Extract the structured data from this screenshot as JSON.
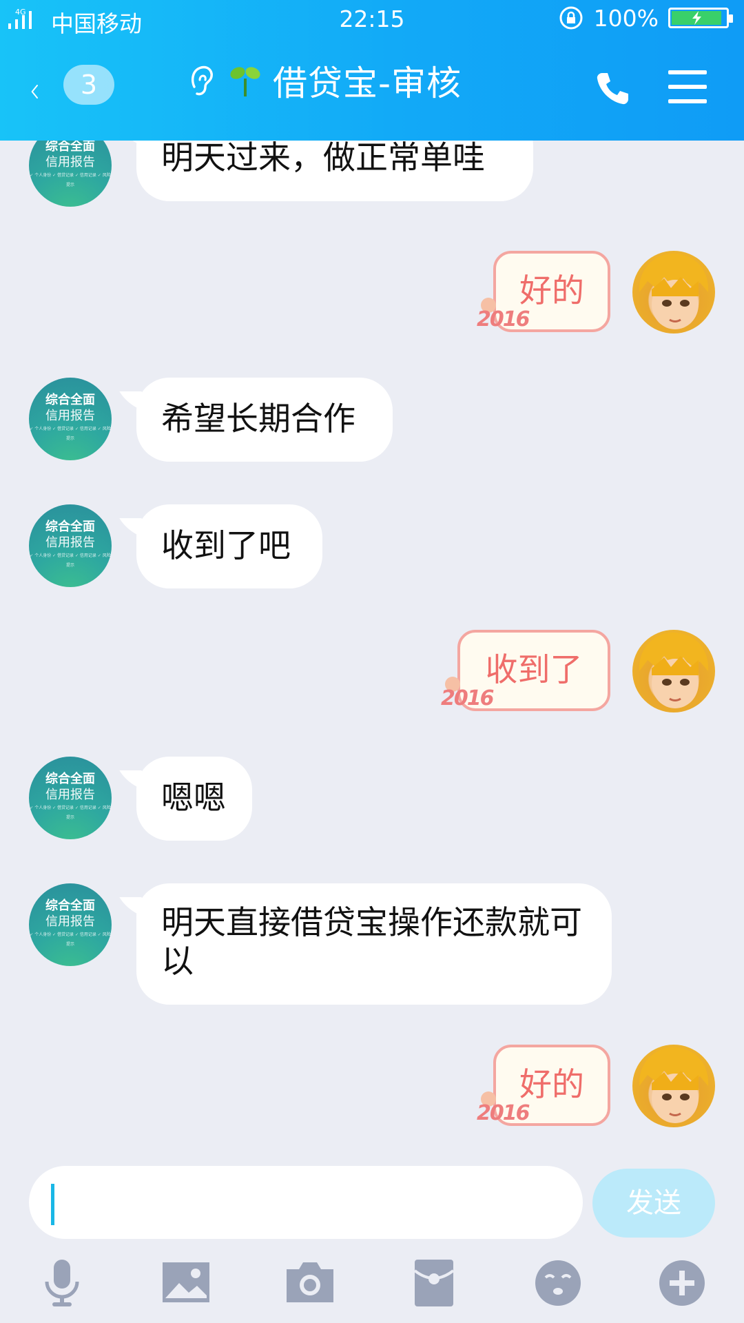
{
  "status_bar": {
    "signal": "4G",
    "carrier": "中国移动",
    "time": "22:15",
    "battery": "100%"
  },
  "header": {
    "unread_count": "3",
    "title": "借贷宝-审核"
  },
  "contact_avatar": {
    "line1": "综合全面",
    "line2": "信用报告",
    "line3": "✓ 个人身份 ✓ 借贷记录 ✓ 信用记录 ✓ 风险提示"
  },
  "messages": [
    {
      "side": "left",
      "text": "明天过来，做正常单哇"
    },
    {
      "side": "right",
      "text": "好的",
      "deco": "2016"
    },
    {
      "side": "left",
      "text": "希望长期合作"
    },
    {
      "side": "left",
      "text": "收到了吧"
    },
    {
      "side": "right",
      "text": "收到了",
      "deco": "2016"
    },
    {
      "side": "left",
      "text": "嗯嗯"
    },
    {
      "side": "left",
      "text": "明天直接借贷宝操作还款就可以"
    },
    {
      "side": "right",
      "text": "好的",
      "deco": "2016"
    }
  ],
  "input": {
    "value": "",
    "send_label": "发送"
  },
  "toolbar": [
    "microphone-icon",
    "image-icon",
    "camera-icon",
    "red-packet-icon",
    "emoji-icon",
    "plus-icon"
  ]
}
